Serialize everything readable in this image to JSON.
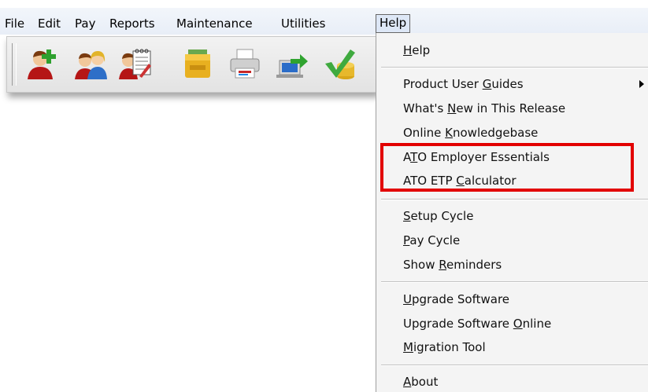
{
  "menubar": {
    "items": [
      "File",
      "Edit",
      "Pay",
      "Reports",
      "Maintenance",
      "Utilities",
      "Help"
    ],
    "active": "Help"
  },
  "toolbar": {
    "tools": [
      "add-employee-icon",
      "employees-icon",
      "timesheet-icon",
      "folder-icon",
      "printer-icon",
      "export-icon",
      "checkmark-coins-icon"
    ]
  },
  "help_menu": {
    "groups": [
      [
        {
          "label": "Help"
        }
      ],
      [
        {
          "label": "Product User Guides",
          "submenu": true
        },
        {
          "label": "What's New in This Release"
        },
        {
          "label": "Online Knowledgebase"
        },
        {
          "label": "ATO Employer Essentials"
        },
        {
          "label": "ATO ETP Calculator"
        }
      ],
      [
        {
          "label": "Setup Cycle"
        },
        {
          "label": "Pay Cycle"
        },
        {
          "label": "Show Reminders"
        }
      ],
      [
        {
          "label": "Upgrade Software"
        },
        {
          "label": "Upgrade Software Online"
        },
        {
          "label": "Migration Tool"
        }
      ],
      [
        {
          "label": "About"
        }
      ]
    ],
    "highlighted": [
      "ATO Employer Essentials",
      "ATO ETP Calculator"
    ],
    "highlight_color": "#e20000"
  }
}
